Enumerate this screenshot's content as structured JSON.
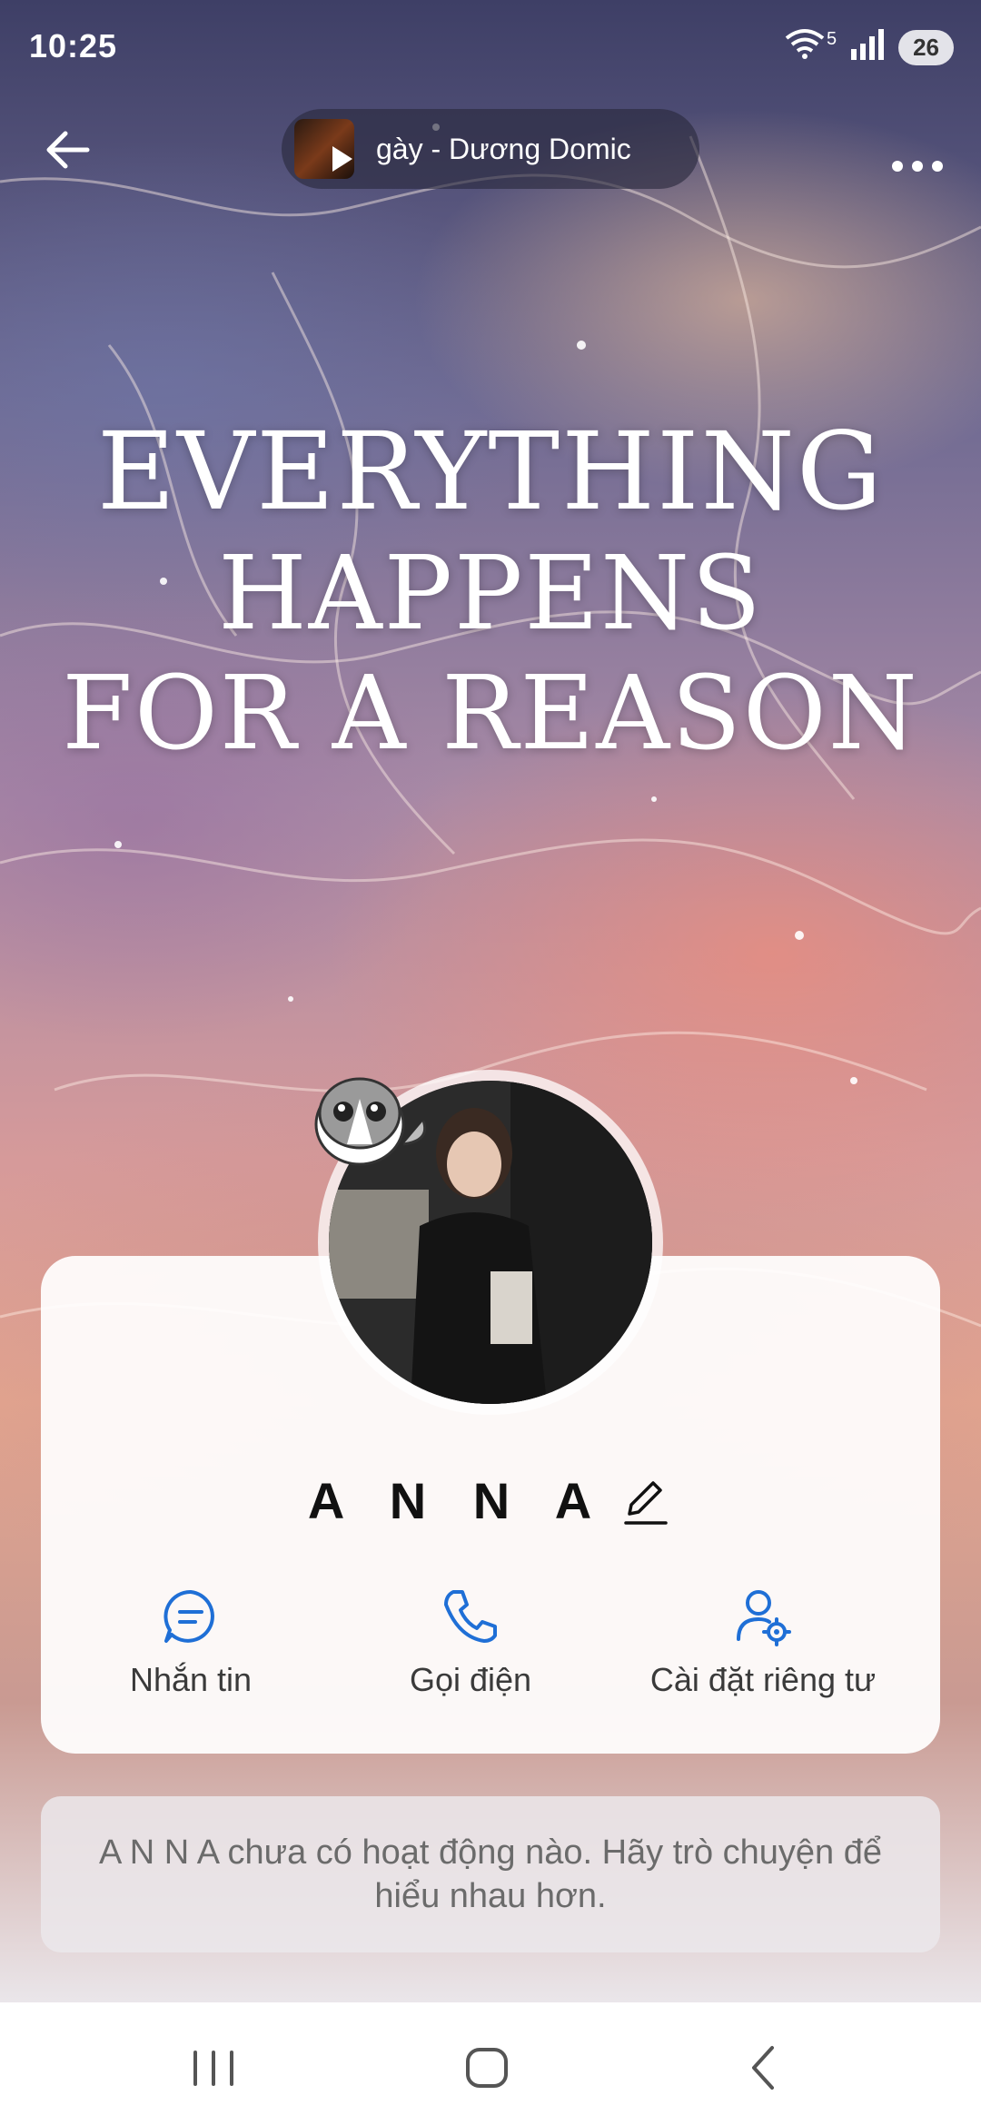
{
  "status_bar": {
    "time": "10:25",
    "wifi_badge": "5",
    "battery": "26"
  },
  "top_bar": {
    "now_playing": "gày - Dương Domic",
    "back_icon": "arrow-left-icon",
    "more_icon": "more-horizontal-icon"
  },
  "cover": {
    "line1": "EVERYTHING",
    "line2": "HAPPENS",
    "line3": "FOR A REASON"
  },
  "profile": {
    "name": "A N N A",
    "edit_icon": "pencil-icon"
  },
  "actions": [
    {
      "label": "Nhắn tin",
      "icon": "chat-icon"
    },
    {
      "label": "Gọi điện",
      "icon": "phone-icon"
    },
    {
      "label": "Cài đặt riêng tư",
      "icon": "user-settings-icon"
    }
  ],
  "activity_note": "A N N A chưa có hoạt động nào. Hãy trò chuyện để hiểu nhau hơn.",
  "colors": {
    "accent": "#1f6fd6",
    "card": "#ffffff",
    "muted_text": "#6b6b6b"
  }
}
